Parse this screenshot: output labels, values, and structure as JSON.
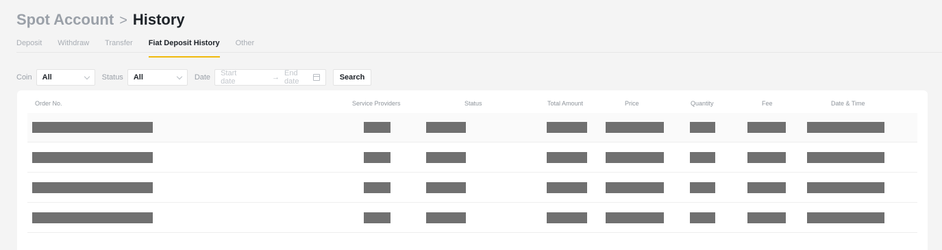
{
  "header": {
    "parent": "Spot Account",
    "separator": ">",
    "current": "History"
  },
  "tabs": [
    {
      "label": "Deposit",
      "active": false
    },
    {
      "label": "Withdraw",
      "active": false
    },
    {
      "label": "Transfer",
      "active": false
    },
    {
      "label": "Fiat Deposit History",
      "active": true
    },
    {
      "label": "Other",
      "active": false
    }
  ],
  "filters": {
    "coin_label": "Coin",
    "coin_value": "All",
    "status_label": "Status",
    "status_value": "All",
    "date_label": "Date",
    "start_placeholder": "Start date",
    "arrow": "→",
    "end_placeholder": "End date",
    "search_label": "Search"
  },
  "table": {
    "columns": [
      "Order No.",
      "Service Providers",
      "Status",
      "Total Amount",
      "Price",
      "Quantity",
      "Fee",
      "Date & Time"
    ],
    "row_count": 4,
    "cells_redacted": true
  },
  "colors": {
    "accent": "#f0b90b",
    "redaction": "#707070"
  }
}
